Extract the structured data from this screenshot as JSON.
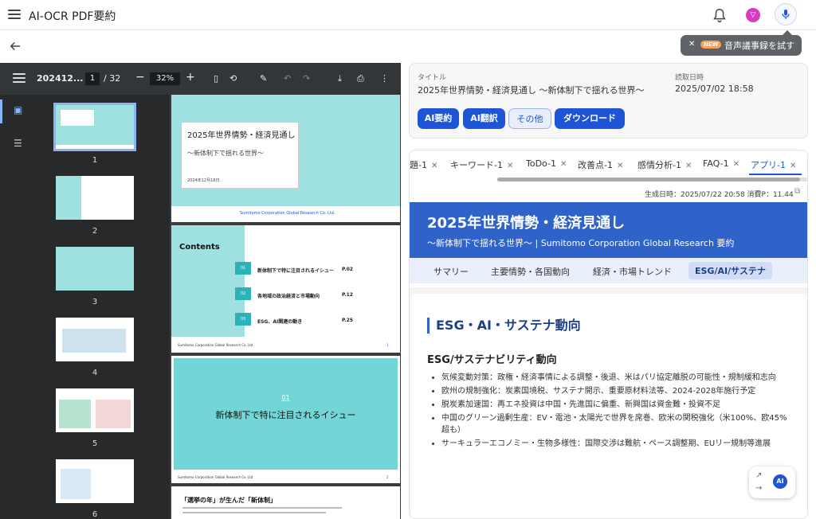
{
  "app": {
    "title": "AI-OCR PDF要約"
  },
  "tooltip": {
    "new_badge": "NEW",
    "label": "音声議事録を試す"
  },
  "pdf": {
    "filename": "202412...",
    "page_current": "1",
    "page_total": "/ 32",
    "zoom": "32%",
    "thumbs": [
      "1",
      "2",
      "3",
      "4",
      "5",
      "6"
    ],
    "page1": {
      "title": "2025年世界情勢・経済見通し",
      "subtitle": "〜新体制下で揺れる世界〜",
      "date": "2024年12月18日",
      "footer": "Sumitomo Corporation Global Research Co. Ltd."
    },
    "page2": {
      "heading": "Contents",
      "items": [
        {
          "num": "01",
          "text": "新体制下で特に注目されるイシュー",
          "page": "P.02"
        },
        {
          "num": "02",
          "text": "各地域の政治経済と市場動向",
          "page": "P.12"
        },
        {
          "num": "03",
          "text": "ESG、AI関連の動き",
          "page": "P.25"
        }
      ],
      "footer": "Sumitomo Corporation Global Research Co. Ltd",
      "pagenum": "1"
    },
    "page3": {
      "num": "01",
      "title": "新体制下で特に注目されるイシュー",
      "footer": "Sumitomo Corporation Global Research Co. Ltd",
      "pagenum": "2"
    },
    "page4": {
      "heading": "「選挙の年」が生んだ「新体制」"
    }
  },
  "doc": {
    "title_label": "タイトル",
    "title": "2025年世界情勢・経済見通し 〜新体制下で揺れる世界〜",
    "date_label": "読取日時",
    "date": "2025/07/02 18:58",
    "buttons": [
      "AI要約",
      "AI翻訳",
      "その他",
      "ダウンロード"
    ]
  },
  "tabs": [
    "題-1",
    "キーワード-1",
    "ToDo-1",
    "改善点-1",
    "感情分析-1",
    "FAQ-1",
    "アプリ-1"
  ],
  "report": {
    "meta": "生成日時：2025/07/22 20:58  消費P：11.44",
    "title": "2025年世界情勢・経済見通し",
    "subtitle": "〜新体制下で揺れる世界〜 | Sumitomo Corporation Global Research 要約",
    "nav": [
      "サマリー",
      "主要情勢・各国動向",
      "経済・市場トレンド",
      "ESG/AI/サステナ"
    ],
    "section_title": "ESG・AI・サステナ動向",
    "subsection": "ESG/サステナビリティ動向",
    "bullets": [
      "気候変動対策：政権・経済事情による調整・後退、米はパリ協定離脱の可能性・規制緩和志向",
      "欧州の規制強化：炭素国境税、サステナ開示、重要原材料法等、2024-2028年施行予定",
      "脱炭素加速国：再エネ投資は中国・先進国に偏重、新興国は資金難・投資不足",
      "中国のグリーン過剰生産：EV・電池・太陽光で世界を席巻、欧米の関税強化（米100%、欧45%超も）",
      "サーキュラーエコノミー・生物多様性：国際交渉は難航・ペース調整期、EUリー規制等進展"
    ]
  },
  "fab": {
    "label": "AI"
  }
}
